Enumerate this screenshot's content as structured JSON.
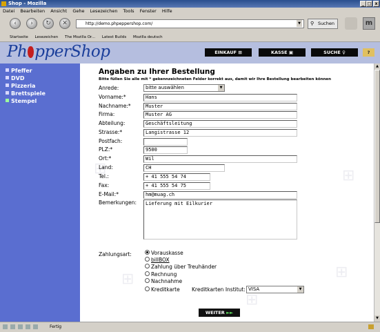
{
  "window": {
    "title": "Shop - Mozilla"
  },
  "menu": [
    "Datei",
    "Bearbeiten",
    "Ansicht",
    "Gehe",
    "Lesezeichen",
    "Tools",
    "Fenster",
    "Hilfe"
  ],
  "nav": {
    "url": "http://demo.phpeppershop.com/",
    "search_label": "Suchen"
  },
  "bookmarks": [
    "Startseite",
    "Lesezeichen",
    "The Mozilla Or...",
    "Latest Builds",
    "Mozilla deutsch"
  ],
  "header": {
    "logo_pre": "Ph",
    "logo_post": "pperShop",
    "buttons": [
      "EINKAUF",
      "KASSE",
      "SUCHE"
    ]
  },
  "sidebar": {
    "items": [
      {
        "label": "Pfeffer",
        "bullet": "#d8d8ff"
      },
      {
        "label": "DVD",
        "bullet": "#d8d8ff"
      },
      {
        "label": "Pizzeria",
        "bullet": "#d8d8ff"
      },
      {
        "label": "Brettspiele",
        "bullet": "#d8d8ff"
      },
      {
        "label": "Stempel",
        "bullet": "#9dff9d"
      }
    ]
  },
  "form": {
    "heading": "Angaben zu Ihrer Bestellung",
    "hint": "Bitte füllen Sie alle mit * gekennzeichneten Felder korrekt aus, damit wir Ihre Bestellung bearbeiten können",
    "anrede": {
      "label": "Anrede:",
      "value": "bitte auswählen"
    },
    "vorname": {
      "label": "Vorname:*",
      "value": "Hans"
    },
    "nachname": {
      "label": "Nachname:*",
      "value": "Muster"
    },
    "firma": {
      "label": "Firma:",
      "value": "Muster AG"
    },
    "abteilung": {
      "label": "Abteilung:",
      "value": "Geschäftsleitung"
    },
    "strasse": {
      "label": "Strasse:*",
      "value": "Langistrasse 12"
    },
    "postfach": {
      "label": "Postfach:",
      "value": ""
    },
    "plz": {
      "label": "PLZ:*",
      "value": "9500"
    },
    "ort": {
      "label": "Ort:*",
      "value": "Wil"
    },
    "land": {
      "label": "Land:",
      "value": "CH"
    },
    "tel": {
      "label": "Tel.:",
      "value": "+ 41 555 54 74"
    },
    "fax": {
      "label": "Fax:",
      "value": "+ 41 555 54 75"
    },
    "email": {
      "label": "E-Mail:*",
      "value": "hm@muag.ch"
    },
    "bemerkungen": {
      "label": "Bemerkungen:",
      "value": "Lieferung mit Eilkurier"
    }
  },
  "payment": {
    "label": "Zahlungsart:",
    "options": [
      {
        "label": "Vorauskasse",
        "selected": true
      },
      {
        "label": "billBOX",
        "selected": false
      },
      {
        "label": "Zahlung über Treuhänder",
        "selected": false
      },
      {
        "label": "Rechnung",
        "selected": false
      },
      {
        "label": "Nachnahme",
        "selected": false
      },
      {
        "label": "Kreditkarte",
        "selected": false
      }
    ],
    "card_institute_label": "Kreditkarten Institut:",
    "card_institute_value": "VISA"
  },
  "submit_label": "WEITER",
  "status": {
    "text": "Fertig"
  }
}
